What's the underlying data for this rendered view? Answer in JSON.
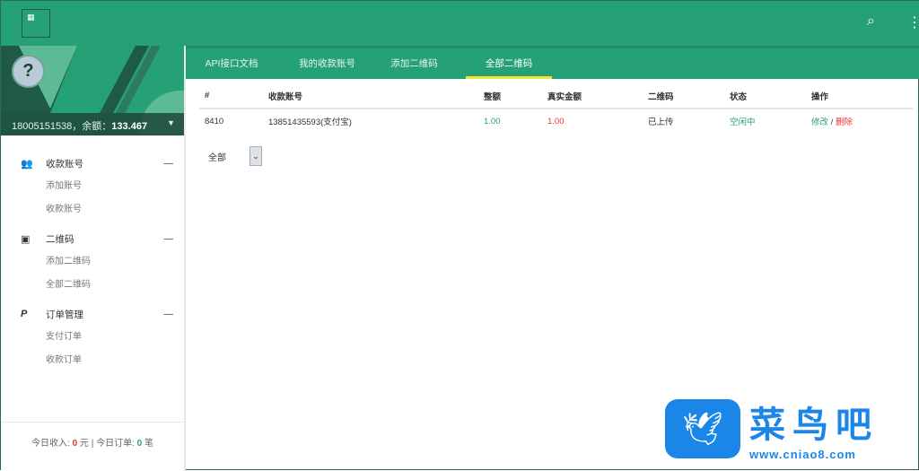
{
  "topbar": {
    "search_icon": "search-icon",
    "more_icon": "more-vertical-icon"
  },
  "sidebar": {
    "account": "18005151538，余额：",
    "balance": "133.467",
    "groups": [
      {
        "label": "收款账号",
        "icon": "users-icon",
        "items": [
          "添加账号",
          "收款账号"
        ]
      },
      {
        "label": "二维码",
        "icon": "id-card-icon",
        "items": [
          "添加二维码",
          "全部二维码"
        ]
      },
      {
        "label": "订单管理",
        "icon": "paypal-icon",
        "items": [
          "支付订单",
          "收款订单"
        ]
      }
    ],
    "footer": {
      "income_label": "今日收入:",
      "income": "0",
      "income_unit": "元",
      "sep": "|",
      "orders_label": "今日订单:",
      "orders": "0",
      "orders_unit": "笔"
    }
  },
  "tabs": [
    "API接口文档",
    "我的收款账号",
    "添加二维码",
    "全部二维码"
  ],
  "table": {
    "headers": [
      "#",
      "收款账号",
      "整额",
      "真实金额",
      "二维码",
      "状态",
      "操作"
    ],
    "rows": [
      {
        "id": "8410",
        "account": "13851435593(支付宝)",
        "amount": "1.00",
        "real": "1.00",
        "qr": "已上传",
        "status": "空闲中",
        "edit": "修改",
        "sep": "/",
        "del": "删除"
      }
    ]
  },
  "filter": {
    "value": "全部"
  },
  "watermark": {
    "name": "菜鸟吧",
    "url": "www.cniao8.com"
  },
  "colors": {
    "primary": "#26a075",
    "danger": "#e33",
    "tab_indicator": "#f5e23a"
  }
}
